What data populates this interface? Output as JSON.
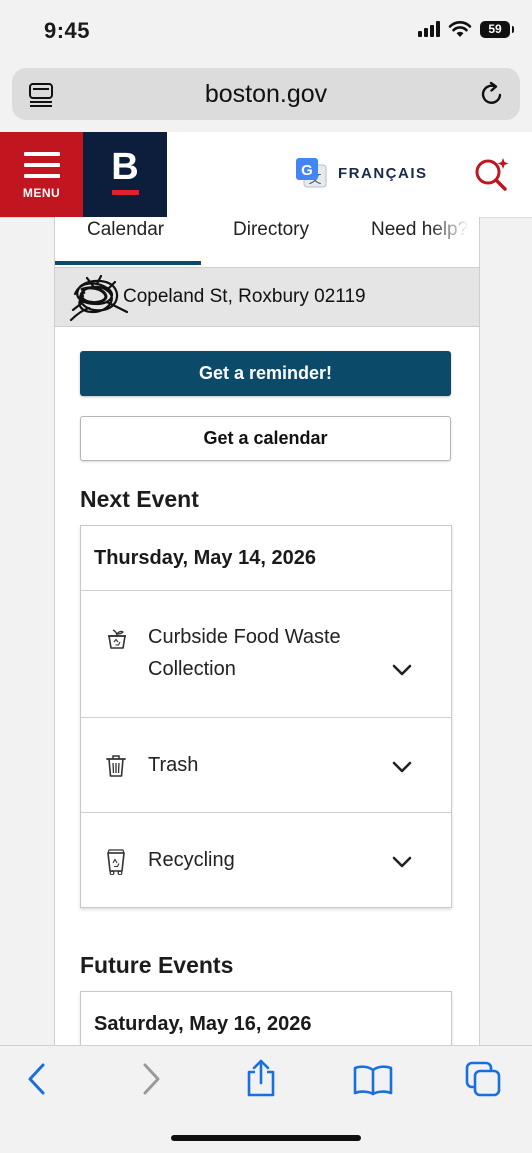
{
  "status_bar": {
    "time": "9:45",
    "battery": "59"
  },
  "browser": {
    "url": "boston.gov"
  },
  "site_header": {
    "menu_label": "MENU",
    "logo_letter": "B",
    "language": "FRANÇAIS"
  },
  "tabs": [
    {
      "label": "Calendar",
      "active": true
    },
    {
      "label": "Directory",
      "active": false
    },
    {
      "label": "Need help?",
      "active": false
    }
  ],
  "address": "Copeland St, Roxbury 02119",
  "buttons": {
    "reminder": "Get a reminder!",
    "calendar": "Get a calendar"
  },
  "next_event": {
    "title": "Next Event",
    "date": "Thursday, May 14, 2026",
    "items": [
      {
        "label": "Curbside Food Waste Collection",
        "icon": "food-waste-icon"
      },
      {
        "label": "Trash",
        "icon": "trash-can-icon"
      },
      {
        "label": "Recycling",
        "icon": "recycling-bin-icon"
      }
    ]
  },
  "future_events": {
    "title": "Future Events",
    "date": "Saturday, May 16, 2026"
  },
  "colors": {
    "brand_red": "#c1161f",
    "brand_navy": "#0c1e3c",
    "button_blue": "#0c4a6a"
  }
}
